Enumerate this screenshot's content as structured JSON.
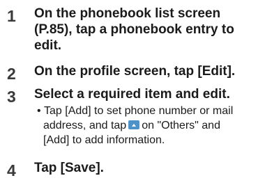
{
  "steps": [
    {
      "num": "1",
      "lines": [
        "On the phonebook list screen",
        "(P.85), tap a phonebook entry to",
        "edit."
      ]
    },
    {
      "num": "2",
      "lines": [
        "On the profile screen, tap [Edit]."
      ]
    },
    {
      "num": "3",
      "lines": [
        "Select a required item and edit."
      ],
      "note": {
        "bullet": "•",
        "line1": "Tap [Add] to set phone number or mail",
        "line2_before_icon": "address, and tap",
        "icon": "up-arrow-icon",
        "line2_after_icon": "on \"Others\" and",
        "line3": "[Add] to add information."
      }
    },
    {
      "num": "4",
      "lines": [
        "Tap [Save]."
      ]
    }
  ]
}
